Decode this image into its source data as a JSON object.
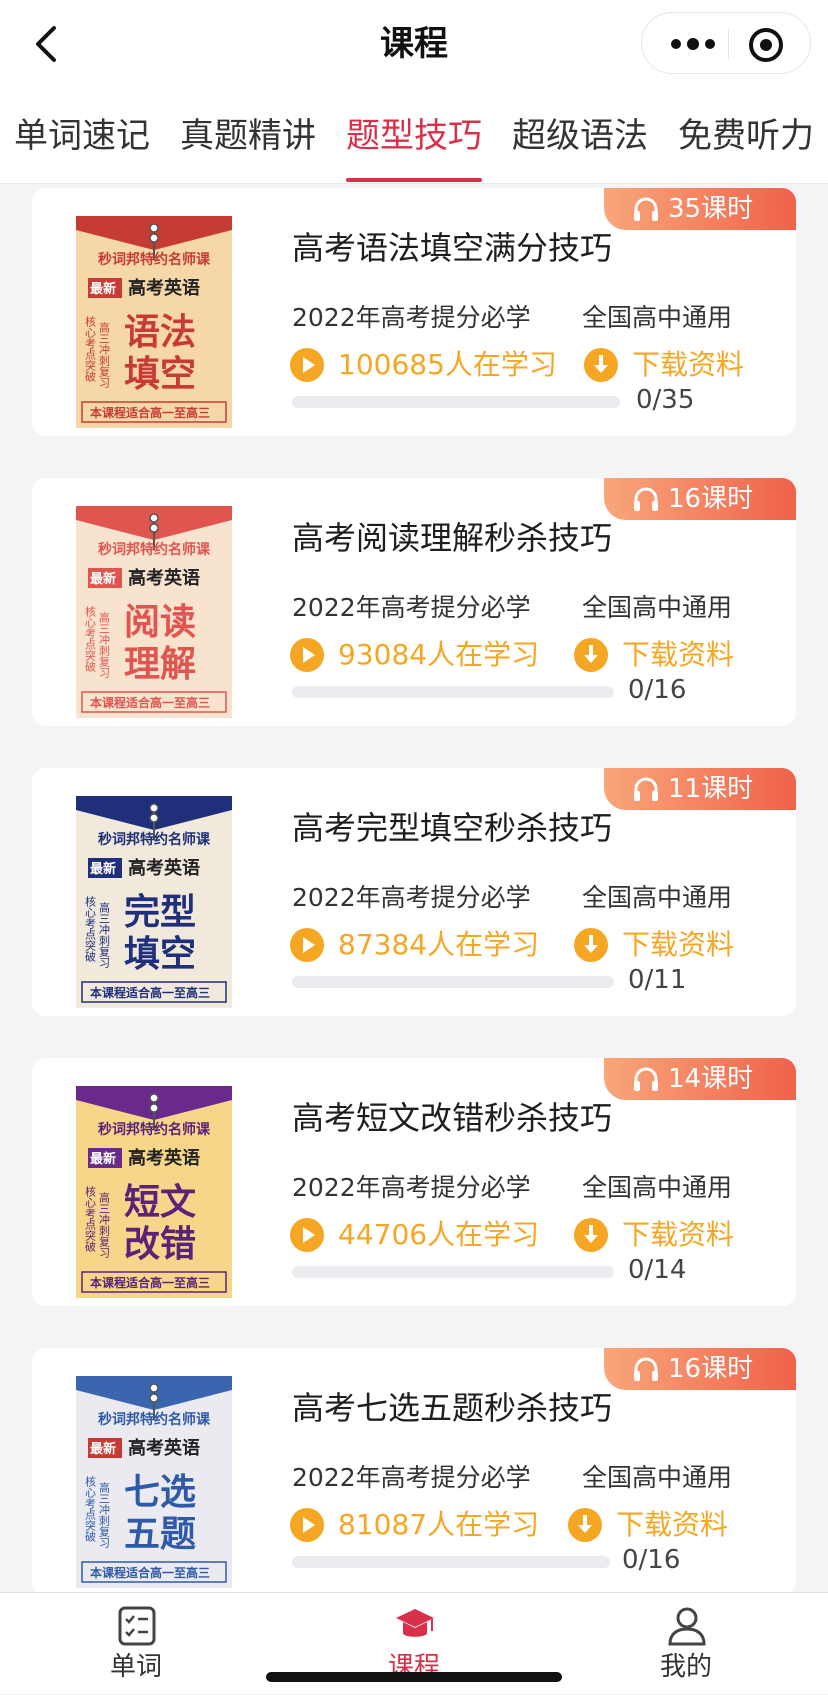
{
  "header": {
    "title": "课程"
  },
  "tabs": [
    {
      "label": "单词速记"
    },
    {
      "label": "真题精讲"
    },
    {
      "label": "题型技巧",
      "active": true
    },
    {
      "label": "超级语法"
    },
    {
      "label": "免费听力"
    }
  ],
  "courses": [
    {
      "hours": "35课时",
      "title": "高考语法填空满分技巧",
      "subtitle": "2022年高考提分必学",
      "scope": "全国高中通用",
      "learners": "100685人在学习",
      "download": "下载资料",
      "progress_text": "0/35",
      "progress": 0,
      "cover": {
        "brand": "秒词邦特约名师课",
        "tag": "最新",
        "heading": "高考英语",
        "side": "高三冲刺复习",
        "side2": "核心考点突破",
        "topic1": "语法",
        "topic2": "填空",
        "footer": "本课程适合高一至高三",
        "theme": "#c73b35",
        "text_color": "#c73b35",
        "bg": "#f6d8a8"
      }
    },
    {
      "hours": "16课时",
      "title": "高考阅读理解秒杀技巧",
      "subtitle": "2022年高考提分必学",
      "scope": "全国高中通用",
      "learners": "93084人在学习",
      "download": "下载资料",
      "progress_text": "0/16",
      "progress": 0,
      "cover": {
        "brand": "秒词邦特约名师课",
        "tag": "最新",
        "heading": "高考英语",
        "side": "高三冲刺复习",
        "side2": "核心考点突破",
        "topic1": "阅读",
        "topic2": "理解",
        "footer": "本课程适合高一至高三",
        "theme": "#e0554f",
        "text_color": "#e0554f",
        "bg": "#f8e3cf"
      }
    },
    {
      "hours": "11课时",
      "title": "高考完型填空秒杀技巧",
      "subtitle": "2022年高考提分必学",
      "scope": "全国高中通用",
      "learners": "87384人在学习",
      "download": "下载资料",
      "progress_text": "0/11",
      "progress": 0,
      "cover": {
        "brand": "秒词邦特约名师课",
        "tag": "最新",
        "heading": "高考英语",
        "side": "高三冲刺复习",
        "side2": "核心考点突破",
        "topic1": "完型",
        "topic2": "填空",
        "footer": "本课程适合高一至高三",
        "theme": "#1f2f7a",
        "text_color": "#1f2f7a",
        "bg": "#f1e9dc"
      }
    },
    {
      "hours": "14课时",
      "title": "高考短文改错秒杀技巧",
      "subtitle": "2022年高考提分必学",
      "scope": "全国高中通用",
      "learners": "44706人在学习",
      "download": "下载资料",
      "progress_text": "0/14",
      "progress": 0,
      "cover": {
        "brand": "秒词邦特约名师课",
        "tag": "最新",
        "heading": "高考英语",
        "side": "高三冲刺复习",
        "side2": "核心考点突破",
        "topic1": "短文",
        "topic2": "改错",
        "footer": "本课程适合高一至高三",
        "theme": "#6a2a8c",
        "text_color": "#5a2378",
        "bg": "#f6d78a"
      }
    },
    {
      "hours": "16课时",
      "title": "高考七选五题秒杀技巧",
      "subtitle": "2022年高考提分必学",
      "scope": "全国高中通用",
      "learners": "81087人在学习",
      "download": "下载资料",
      "progress_text": "0/16",
      "progress": 0,
      "cover": {
        "brand": "秒词邦特约名师课",
        "tag": "最新",
        "heading": "高考英语",
        "side": "高三冲刺复习",
        "side2": "核心考点突破",
        "topic1": "七选",
        "topic2": "五题",
        "footer": "本课程适合高一至高三",
        "theme": "#3a66b0",
        "text_color": "#2f5aa8",
        "bg": "#eaeaf0"
      }
    }
  ],
  "bottom_nav": [
    {
      "label": "单词",
      "icon": "checklist-icon"
    },
    {
      "label": "课程",
      "icon": "graduation-cap-icon",
      "active": true
    },
    {
      "label": "我的",
      "icon": "user-icon"
    }
  ],
  "colors": {
    "accent": "#d9304a",
    "orange": "#f5a623"
  }
}
